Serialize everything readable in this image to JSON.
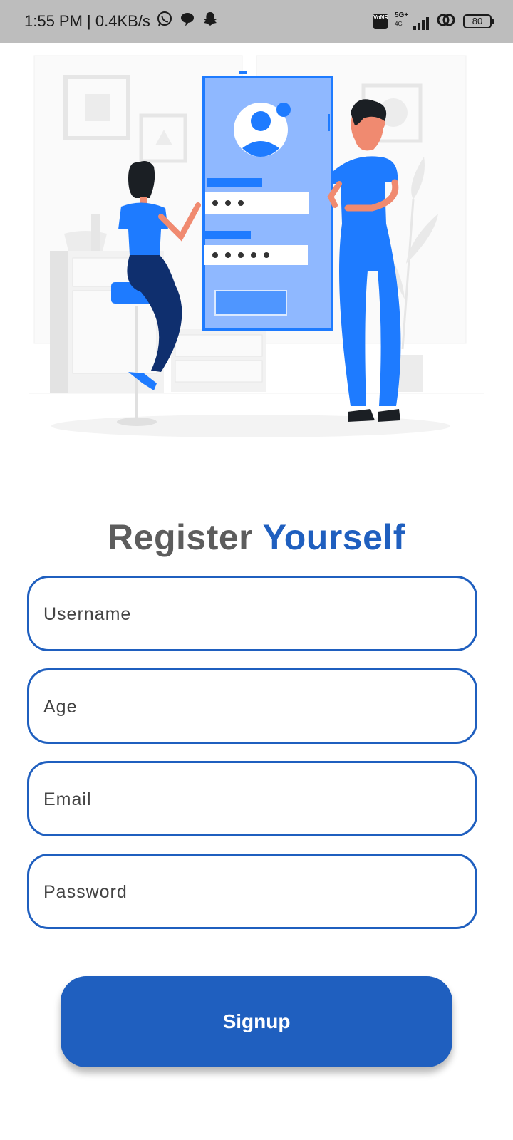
{
  "status_bar": {
    "time_speed": "1:55 PM | 0.4KB/s",
    "volte_icon": "VoNR",
    "network_type": "5G+",
    "network_sub": "4G",
    "battery": "80",
    "icons": [
      "whatsapp-icon",
      "chat-bubble-icon",
      "snapchat-icon",
      "volte-icon",
      "signal-icon",
      "hotspot-icon",
      "battery-icon"
    ]
  },
  "illustration": {
    "semantic": "registration-illustration",
    "primary_color": "#1f5fbf",
    "accent_color": "#1e7bff"
  },
  "form": {
    "title_part1": "Register",
    "title_part2": "Yourself",
    "username_placeholder": "Username",
    "age_placeholder": "Age",
    "email_placeholder": "Email",
    "password_placeholder": "Password",
    "signup_label": "Signup"
  },
  "colors": {
    "brand": "#1f5fbf",
    "title_gray": "#5d5d5d",
    "status_bar_bg": "#bdbdbd"
  }
}
